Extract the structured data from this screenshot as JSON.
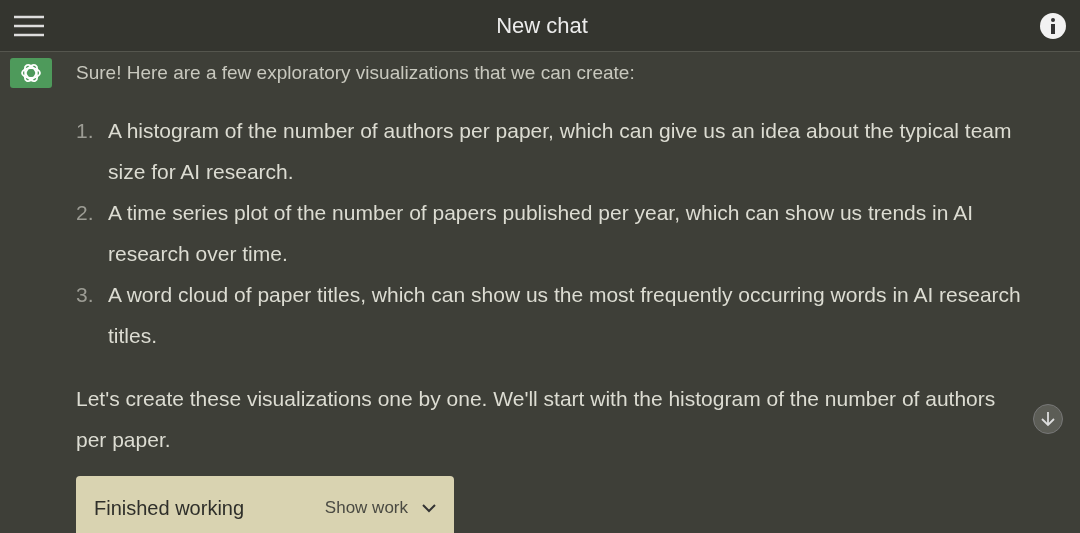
{
  "header": {
    "title": "New chat"
  },
  "message": {
    "intro": "Sure! Here are a few exploratory visualizations that we can create:",
    "items": [
      {
        "number": "1.",
        "text": "A histogram of the number of authors per paper, which can give us an idea about the typical team size for AI research."
      },
      {
        "number": "2.",
        "text": "A time series plot of the number of papers published per year, which can show us trends in AI research over time."
      },
      {
        "number": "3.",
        "text": "A word cloud of paper titles, which can show us the most frequently occurring words in AI research titles."
      }
    ],
    "closing": "Let's create these visualizations one by one. We'll start with the histogram of the number of authors per paper.",
    "work": {
      "status": "Finished working",
      "toggle": "Show work",
      "expanded": false
    }
  }
}
